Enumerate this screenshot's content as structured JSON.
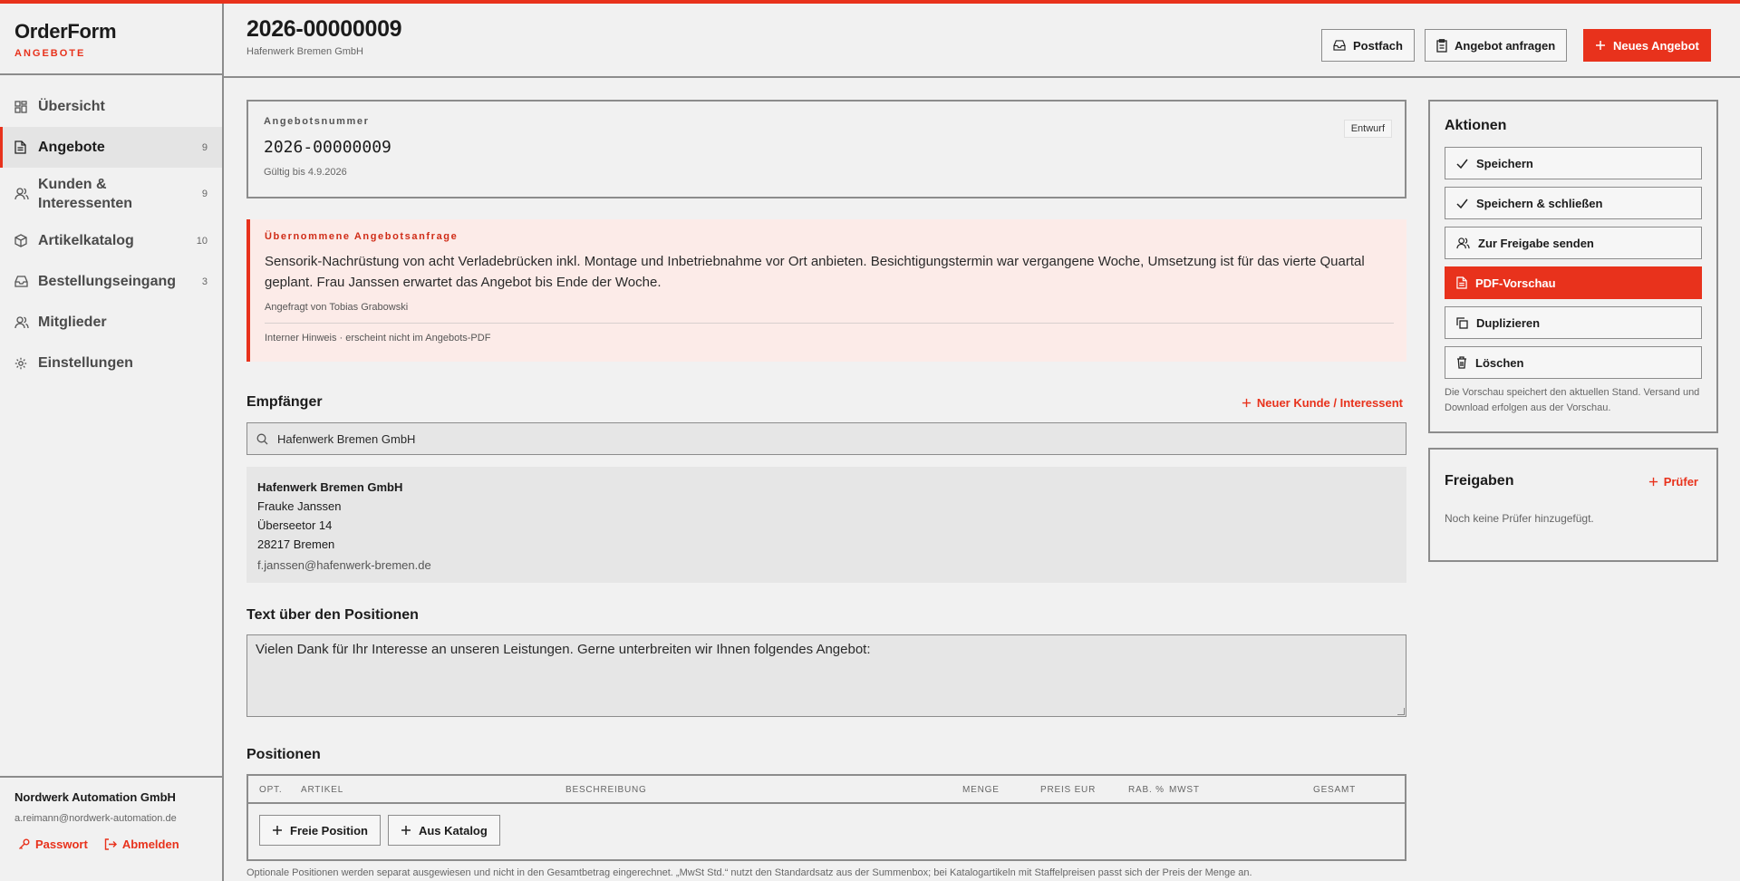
{
  "brand": {
    "name": "OrderForm",
    "sub": "ANGEBOTE"
  },
  "nav": [
    {
      "label": "Übersicht",
      "count": ""
    },
    {
      "label": "Angebote",
      "count": "9"
    },
    {
      "label": "Kunden & Interessenten",
      "count": "9"
    },
    {
      "label": "Artikelkatalog",
      "count": "10"
    },
    {
      "label": "Bestellungseingang",
      "count": "3"
    },
    {
      "label": "Mitglieder",
      "count": ""
    },
    {
      "label": "Einstellungen",
      "count": ""
    }
  ],
  "account": {
    "company": "Nordwerk Automation GmbH",
    "email": "a.reimann@nordwerk-automation.de",
    "password_label": "Passwort",
    "logout_label": "Abmelden"
  },
  "header": {
    "title": "2026-00000009",
    "subtitle": "Hafenwerk Bremen GmbH",
    "inbox_label": "Postfach",
    "request_label": "Angebot anfragen",
    "new_label": "Neues Angebot"
  },
  "offer": {
    "number_label": "Angebotsnummer",
    "number": "2026-00000009",
    "valid": "Gültig bis 4.9.2026",
    "status": "Entwurf"
  },
  "request": {
    "title": "Übernommene Angebotsanfrage",
    "text": "Sensorik-Nachrüstung von acht Verladebrücken inkl. Montage und Inbetriebnahme vor Ort anbieten. Besichtigungstermin war vergangene Woche, Umsetzung ist für das vierte Quartal geplant. Frau Janssen erwartet das Angebot bis Ende der Woche.",
    "requested_by": "Angefragt von Tobias Grabowski",
    "note": "Interner Hinweis · erscheint nicht im Angebots-PDF"
  },
  "recipient": {
    "title": "Empfänger",
    "new_customer_label": "Neuer Kunde / Interessent",
    "search_value": "Hafenwerk Bremen GmbH",
    "name": "Hafenwerk Bremen GmbH",
    "contact": "Frauke Janssen",
    "street": "Überseetor 14",
    "city": "28217 Bremen",
    "email": "f.janssen@hafenwerk-bremen.de"
  },
  "intro": {
    "title": "Text über den Positionen",
    "text": "Vielen Dank für Ihr Interesse an unseren Leistungen. Gerne unterbreiten wir Ihnen folgendes Angebot:"
  },
  "positions": {
    "title": "Positionen",
    "columns": [
      "OPT.",
      "ARTIKEL",
      "BESCHREIBUNG",
      "MENGE",
      "PREIS EUR",
      "RAB. %",
      "MWST",
      "GESAMT"
    ],
    "free_label": "Freie Position",
    "catalog_label": "Aus Katalog",
    "footnote": "Optionale Positionen werden separat ausgewiesen und nicht in den Gesamtbetrag eingerechnet. „MwSt Std.“ nutzt den Standardsatz aus der Summenbox; bei Katalogartikeln mit Staffelpreisen passt sich der Preis der Menge an."
  },
  "actions": {
    "title": "Aktionen",
    "save": "Speichern",
    "save_close": "Speichern & schließen",
    "approval": "Zur Freigabe senden",
    "pdf": "PDF-Vorschau",
    "duplicate": "Duplizieren",
    "delete": "Löschen",
    "note": "Die Vorschau speichert den aktuellen Stand. Versand und Download erfolgen aus der Vorschau."
  },
  "approvals": {
    "title": "Freigaben",
    "add_label": "Prüfer",
    "empty": "Noch keine Prüfer hinzugefügt."
  },
  "colors": {
    "accent": "#e8321c",
    "border": "#8c8c8c",
    "background": "#f1f1f1"
  }
}
